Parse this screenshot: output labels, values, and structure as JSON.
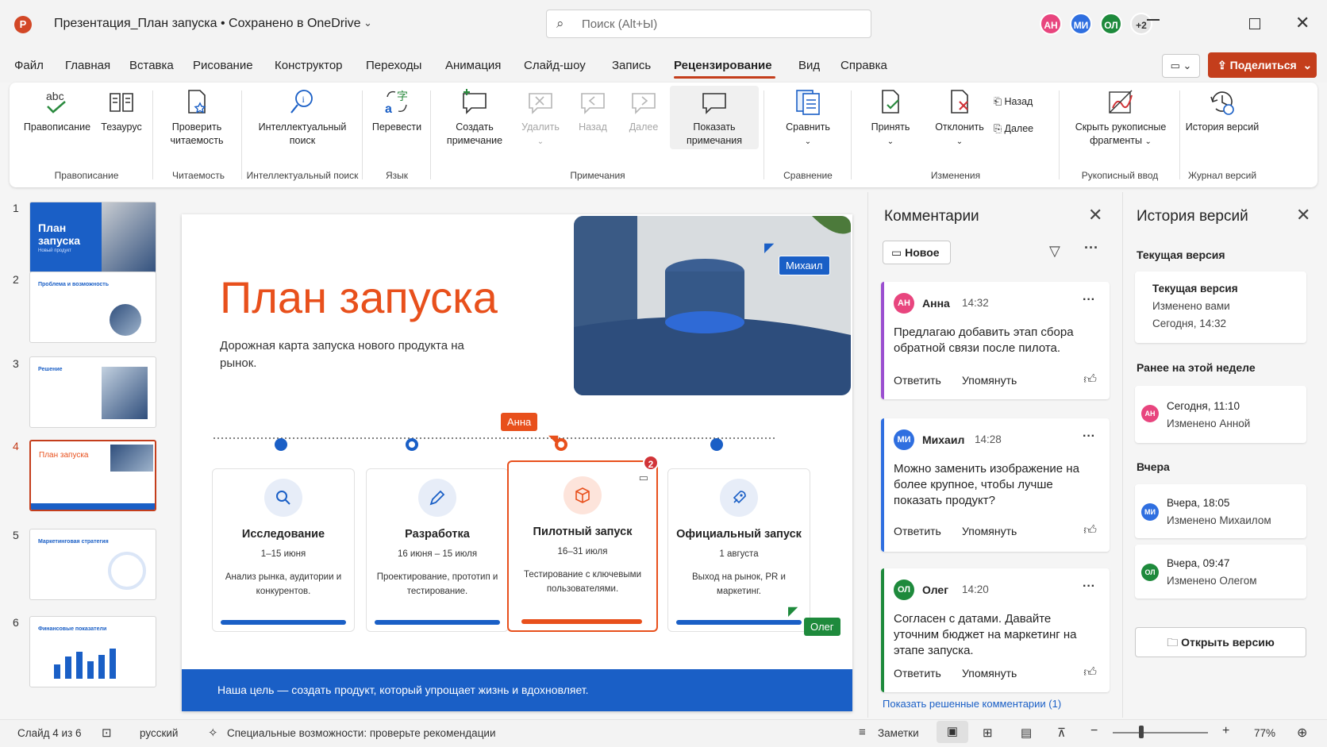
{
  "titlebar": {
    "app_icon": "P",
    "doc_title": "Презентация_План запуска • Сохранено в OneDrive",
    "search_placeholder": "Поиск (Alt+Ы)",
    "avatars": [
      {
        "initials": "АН",
        "color": "#e8457e"
      },
      {
        "initials": "МИ",
        "color": "#2f6fe0"
      },
      {
        "initials": "ОЛ",
        "color": "#1e8a3c"
      },
      {
        "initials": "+2",
        "color": "#e4e4e4"
      }
    ]
  },
  "menu": {
    "items": [
      "Файл",
      "Главная",
      "Вставка",
      "Рисование",
      "Конструктор",
      "Переходы",
      "Анимация",
      "Слайд-шоу",
      "Запись",
      "Рецензирование",
      "Вид",
      "Справка"
    ],
    "active": "Рецензирование",
    "share_label": "Поделиться"
  },
  "ribbon": {
    "spelling": "Правописание",
    "thesaurus": "Тезаурус",
    "check_readability": "Проверить читаемость",
    "smart_lookup": "Интеллектуальный поиск",
    "translate": "Перевести",
    "new_comment": "Создать примечание",
    "delete": "Удалить",
    "prev": "Назад",
    "next": "Далее",
    "show_comments": "Показать примечания",
    "compare": "Сравнить",
    "accept": "Принять",
    "reject": "Отклонить",
    "changes_back": "Назад",
    "changes_next": "Далее",
    "hide_ink": "Скрыть рукописные фрагменты",
    "version_history": "История версий",
    "groups": {
      "proofing": "Правописание",
      "readability": "Читаемость",
      "insights": "Интеллектуальный поиск",
      "language": "Язык",
      "comments": "Примечания",
      "compare": "Сравнение",
      "changes": "Изменения",
      "ink": "Рукописный ввод",
      "version_log": "Журнал версий"
    }
  },
  "thumbnails": [
    {
      "num": "1",
      "title": "План запуска",
      "sub": "Новый продукт"
    },
    {
      "num": "2",
      "title": "Проблема и возможность"
    },
    {
      "num": "3",
      "title": "Решение"
    },
    {
      "num": "4",
      "title": "План запуска"
    },
    {
      "num": "5",
      "title": "Маркетинговая стратегия"
    },
    {
      "num": "6",
      "title": "Финансовые показатели"
    }
  ],
  "slide": {
    "title": "План запуска",
    "subtitle": "Дорожная карта запуска нового продукта на рынок.",
    "footer": "Наша цель — создать продукт, который упрощает жизнь и вдохновляет.",
    "stages": [
      {
        "title": "Исследование",
        "date": "1–15 июня",
        "desc": "Анализ рынка, аудитории и конкурентов.",
        "icon": "search-icon"
      },
      {
        "title": "Разработка",
        "date": "16 июня – 15 июля",
        "desc": "Проектирование, прототип и тестирование.",
        "icon": "pencil-icon"
      },
      {
        "title": "Пилотный запуск",
        "date": "16–31 июля",
        "desc": "Тестирование с ключевыми пользователями.",
        "icon": "box-icon"
      },
      {
        "title": "Официальный запуск",
        "date": "1 августа",
        "desc": "Выход на рынок, PR и маркетинг.",
        "icon": "rocket-icon"
      }
    ],
    "cursor_tags": {
      "anna": "Анна",
      "mikhail": "Михаил",
      "oleg": "Олег"
    },
    "comment_badge": "2"
  },
  "comments_pane": {
    "title": "Комментарии",
    "new_button": "Новое",
    "comments": [
      {
        "initials": "АН",
        "name": "Анна",
        "time": "14:32",
        "text": "Предлагаю добавить этап сбора обратной связи после пилота.",
        "color": "#e8457e",
        "bar": "#9b4fd0"
      },
      {
        "initials": "МИ",
        "name": "Михаил",
        "time": "14:28",
        "text": "Можно заменить изображение на более крупное, чтобы лучше показать продукт?",
        "color": "#2f6fe0",
        "bar": "#2f6fe0"
      },
      {
        "initials": "ОЛ",
        "name": "Олег",
        "time": "14:20",
        "text": "Согласен с датами. Давайте уточним бюджет на маркетинг на этапе запуска.",
        "color": "#1e8a3c",
        "bar": "#1e8a3c"
      }
    ],
    "reply": "Ответить",
    "mention": "Упомянуть",
    "show_resolved": "Показать решенные комментарии (1)"
  },
  "versions_pane": {
    "title": "История версий",
    "current_section": "Текущая версия",
    "current_card": {
      "title": "Текущая версия",
      "by": "Изменено вами",
      "when": "Сегодня, 14:32"
    },
    "week_section": "Ранее на этой неделе",
    "week_card": {
      "initials": "АН",
      "when": "Сегодня, 11:10",
      "by": "Изменено Анной",
      "color": "#e8457e"
    },
    "yesterday_section": "Вчера",
    "yesterday_cards": [
      {
        "initials": "МИ",
        "when": "Вчера, 18:05",
        "by": "Изменено Михаилом",
        "color": "#2f6fe0"
      },
      {
        "initials": "ОЛ",
        "when": "Вчера, 09:47",
        "by": "Изменено Олегом",
        "color": "#1e8a3c"
      }
    ],
    "open_button": "Открыть версию"
  },
  "statusbar": {
    "slide_counter": "Слайд 4 из 6",
    "language": "русский",
    "accessibility": "Специальные возможности: проверьте рекомендации",
    "notes": "Заметки",
    "zoom": "77%"
  }
}
